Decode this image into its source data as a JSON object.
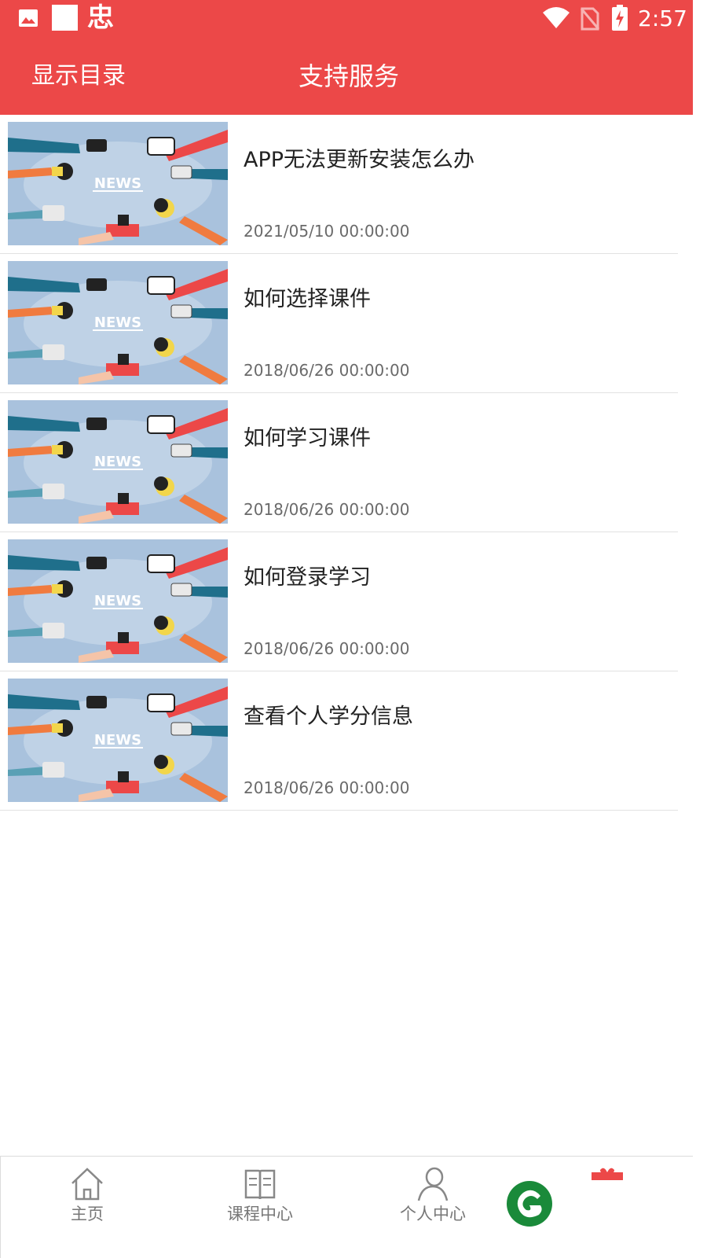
{
  "status_bar": {
    "time": "2:57",
    "icons": [
      "gallery-icon",
      "square-icon",
      "bug-icon",
      "wifi-icon",
      "no-sim-icon",
      "battery-charging-icon"
    ],
    "bug_glyph": "忠"
  },
  "toolbar": {
    "menu_label": "显示目录",
    "title": "支持服务"
  },
  "articles": [
    {
      "title": "APP无法更新安装怎么办",
      "date": "2021/05/10  00:00:00",
      "thumb_label": "NEWS"
    },
    {
      "title": "如何选择课件",
      "date": "2018/06/26  00:00:00",
      "thumb_label": "NEWS"
    },
    {
      "title": "如何学习课件",
      "date": "2018/06/26  00:00:00",
      "thumb_label": "NEWS"
    },
    {
      "title": "如何登录学习",
      "date": "2018/06/26  00:00:00",
      "thumb_label": "NEWS"
    },
    {
      "title": "查看个人学分信息",
      "date": "2018/06/26  00:00:00",
      "thumb_label": "NEWS"
    }
  ],
  "bottom_nav": {
    "items": [
      {
        "label": "主页",
        "icon": "home-icon"
      },
      {
        "label": "课程中心",
        "icon": "book-icon"
      },
      {
        "label": "个人中心",
        "icon": "person-icon"
      }
    ]
  },
  "colors": {
    "primary": "#ec4848",
    "logo_green": "#1a8a3a",
    "thumb_bg": "#a9c2dd"
  }
}
